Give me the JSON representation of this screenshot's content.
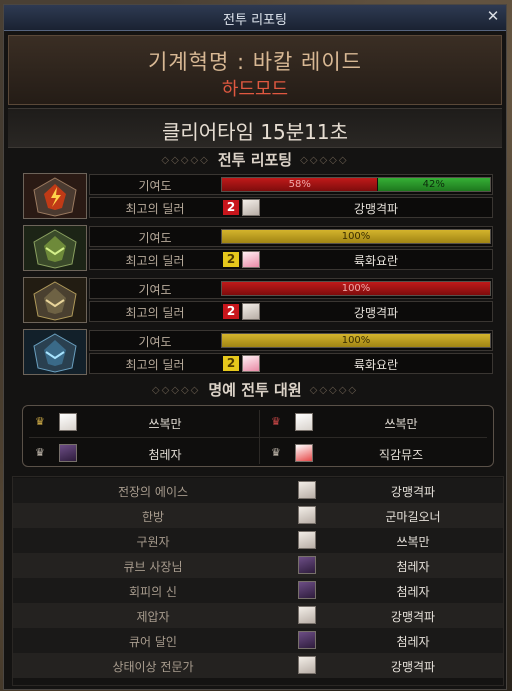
{
  "window": {
    "title": "전투 리포팅",
    "close_icon": "close-icon"
  },
  "header": {
    "raid_name": "기계혁명 : 바칼 레이드",
    "difficulty": "하드모드"
  },
  "clear_time": "클리어타임  15분11초",
  "sections": {
    "battle_report": "전투 리포팅",
    "honor_members": "명예 전투 대원"
  },
  "labels": {
    "contribution": "기여도",
    "top_dealer": "최고의 딜러"
  },
  "colors": {
    "red_bar": "#c01a1a",
    "green_bar": "#36b036",
    "yellow_bar": "#d4b42c",
    "red_badge": "#c8161c",
    "yellow_badge": "#e6c81c"
  },
  "bosses": [
    {
      "icon": "red-mech-boss-icon",
      "contribution": [
        {
          "team": "red",
          "value": 58,
          "label": "58%"
        },
        {
          "team": "green",
          "value": 42,
          "label": "42%"
        }
      ],
      "dealer_team_badge": "2",
      "dealer_badge_color": "red",
      "dealer_name": "강맹격파"
    },
    {
      "icon": "green-mech-boss-icon",
      "contribution": [
        {
          "team": "yellow",
          "value": 100,
          "label": "100%"
        }
      ],
      "dealer_team_badge": "2",
      "dealer_badge_color": "yellow",
      "dealer_name": "륙화요란"
    },
    {
      "icon": "gold-mech-boss-icon",
      "contribution": [
        {
          "team": "red",
          "value": 100,
          "label": "100%"
        }
      ],
      "dealer_team_badge": "2",
      "dealer_badge_color": "red",
      "dealer_name": "강맹격파"
    },
    {
      "icon": "blue-mech-boss-icon",
      "contribution": [
        {
          "team": "yellow",
          "value": 100,
          "label": "100%"
        }
      ],
      "dealer_team_badge": "2",
      "dealer_badge_color": "yellow",
      "dealer_name": "륙화요란"
    }
  ],
  "honor_members": [
    {
      "name": "쓰복만",
      "crown": "gold-crown-icon"
    },
    {
      "name": "쓰복만",
      "crown": "red-crown-icon"
    },
    {
      "name": "첨레자",
      "crown": "silver-crown-icon"
    },
    {
      "name": "직감뮤즈",
      "crown": "silver-crown-icon"
    }
  ],
  "awards": [
    {
      "award": "전장의 에이스",
      "player": "강맹격파"
    },
    {
      "award": "한방",
      "player": "군마길오너"
    },
    {
      "award": "구원자",
      "player": "쓰복만"
    },
    {
      "award": "큐브 사장님",
      "player": "첨레자"
    },
    {
      "award": "회피의 신",
      "player": "첨레자"
    },
    {
      "award": "제압자",
      "player": "강맹격파"
    },
    {
      "award": "큐어 달인",
      "player": "첨레자"
    },
    {
      "award": "상태이상 전문가",
      "player": "강맹격파"
    }
  ]
}
